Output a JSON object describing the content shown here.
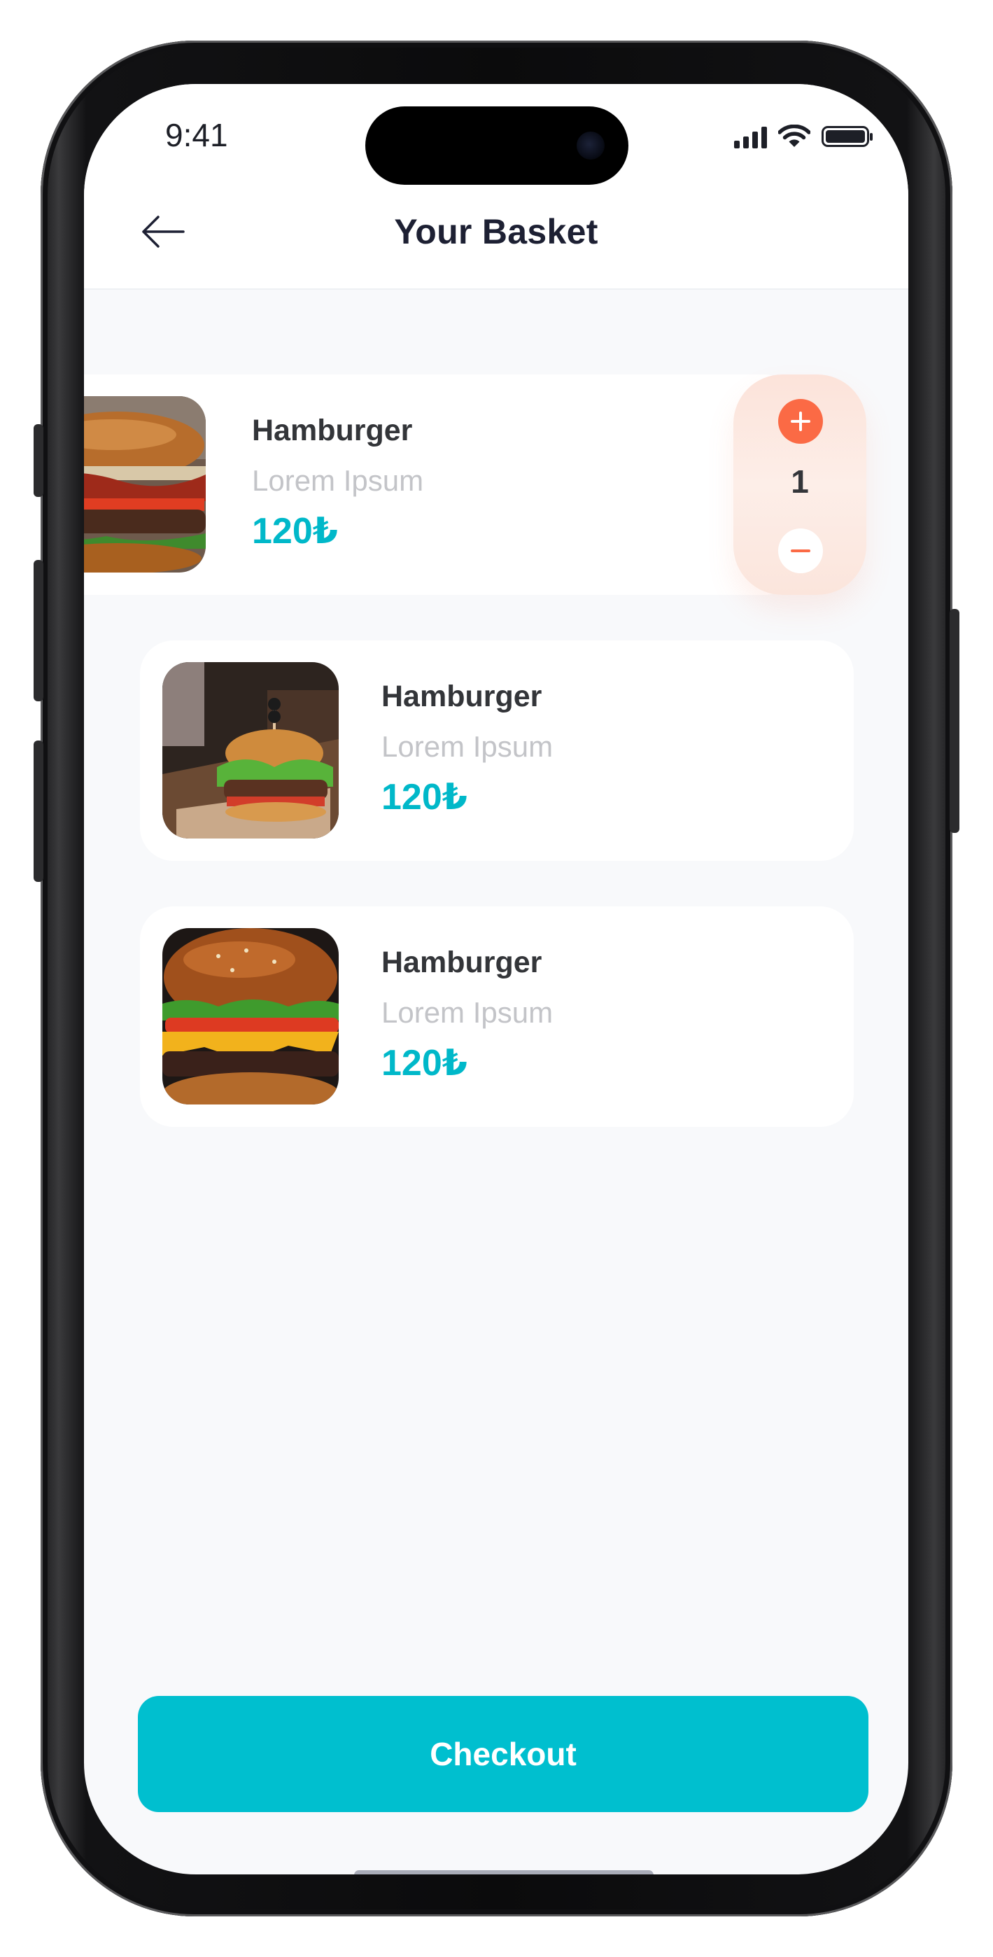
{
  "status_bar": {
    "time": "9:41"
  },
  "header": {
    "title": "Your Basket"
  },
  "basket": {
    "items": [
      {
        "name": "Hamburger",
        "description": "Lorem Ipsum",
        "price": "120₺",
        "quantity": "1"
      },
      {
        "name": "Hamburger",
        "description": "Lorem Ipsum",
        "price": "120₺"
      },
      {
        "name": "Hamburger",
        "description": "Lorem Ipsum",
        "price": "120₺"
      }
    ]
  },
  "footer": {
    "checkout_label": "Checkout"
  },
  "colors": {
    "accent": "#00bfcf",
    "price": "#00b8c9",
    "stepper_accent": "#fb6a45",
    "stepper_bg": "#fde7df",
    "title": "#1d2033",
    "background": "#f8f9fb"
  }
}
